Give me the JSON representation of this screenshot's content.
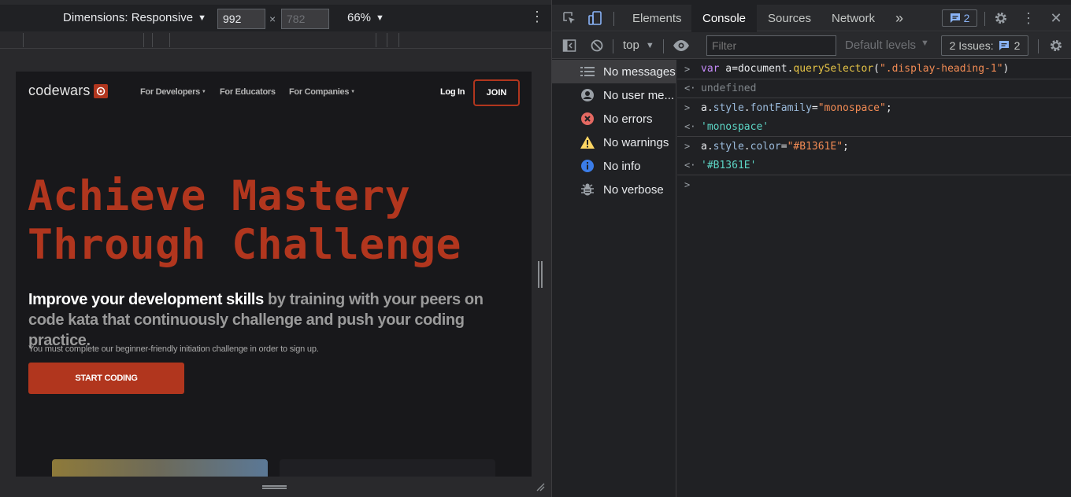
{
  "device_toolbar": {
    "dimensions_label": "Dimensions: Responsive",
    "width_value": "992",
    "height_value": "782",
    "times": "×",
    "zoom_label": "66%"
  },
  "page": {
    "logo_text": "codewars",
    "nav_links": [
      "For Developers",
      "For Educators",
      "For Companies"
    ],
    "login_label": "Log In",
    "join_label": "JOIN",
    "hero_title_line1": "Achieve Mastery",
    "hero_title_line2": "Through Challenge",
    "hero_sub_strong": "Improve your development skills",
    "hero_sub_rest": " by training with your peers on code kata that continuously challenge and push your coding practice.",
    "hero_note": "You must complete our beginner-friendly initiation challenge in order to sign up.",
    "start_button": "START CODING"
  },
  "devtools": {
    "tabs": [
      "Elements",
      "Console",
      "Sources",
      "Network"
    ],
    "active_tab": "Console",
    "more_tabs": "»",
    "issues_count": "2",
    "context_label": "top",
    "filter_placeholder": "Filter",
    "levels_label": "Default levels",
    "issues_label": "2 Issues:",
    "issues_count_2": "2"
  },
  "sidebar": {
    "items": [
      {
        "label": "No messages",
        "icon": "list-icon"
      },
      {
        "label": "No user me...",
        "icon": "user-icon"
      },
      {
        "label": "No errors",
        "icon": "error-icon"
      },
      {
        "label": "No warnings",
        "icon": "warning-icon"
      },
      {
        "label": "No info",
        "icon": "info-icon"
      },
      {
        "label": "No verbose",
        "icon": "bug-icon"
      }
    ]
  },
  "console": {
    "l1_kw": "var",
    "l1_a": " a=document.",
    "l1_fn": "querySelector",
    "l1_p": "(",
    "l1_str": "\".display-heading-1\"",
    "l1_close": ")",
    "r1": "undefined",
    "l2_a": "a.",
    "l2_style": "style",
    "l2_dot": ".",
    "l2_prop": "fontFamily",
    "l2_eq": "=",
    "l2_str": "\"monospace\"",
    "l2_semi": ";",
    "r2": "'monospace'",
    "l3_a": "a.",
    "l3_style": "style",
    "l3_dot": ".",
    "l3_prop": "color",
    "l3_eq": "=",
    "l3_str": "\"#B1361E\"",
    "l3_semi": ";",
    "r3": "'#B1361E'"
  },
  "colors": {
    "accent": "#b1361e",
    "devtools_bg": "#202124",
    "page_bg": "#18181b"
  }
}
